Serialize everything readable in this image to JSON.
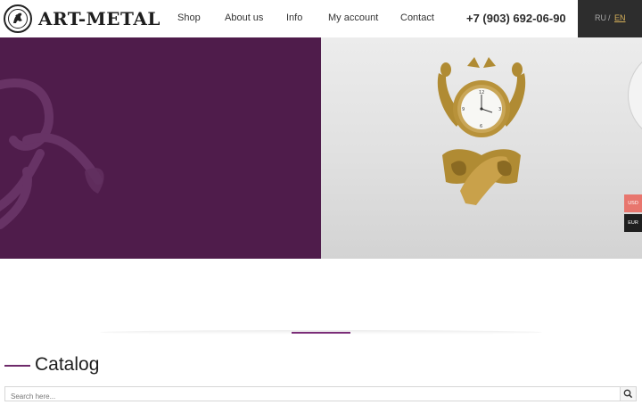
{
  "header": {
    "logo_text": "ART-METAL",
    "nav": [
      "Shop",
      "About us",
      "Info",
      "My account",
      "Contact"
    ],
    "phone": "+7 (903) 692-06-90",
    "languages": [
      "RU",
      "EN"
    ],
    "language_separator": "/",
    "active_language": "EN"
  },
  "hero": {
    "left_color": "#4f1c4b",
    "product_icon": "clock-figurine"
  },
  "currency": [
    "USD",
    "EUR"
  ],
  "catalog": {
    "title": "Catalog",
    "search_placeholder": "Search here..."
  },
  "colors": {
    "accent": "#7b2d78",
    "usd_badge": "#e8766e",
    "active_language": "#d7b15a"
  }
}
